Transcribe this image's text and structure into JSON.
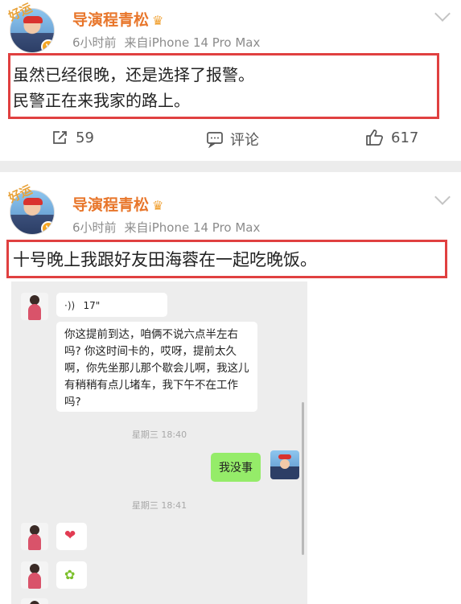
{
  "post1": {
    "author": "导演程青松",
    "lucky_tag": "好运",
    "time": "6小时前",
    "source": "来自iPhone 14 Pro Max",
    "lines": [
      "虽然已经很晚，还是选择了报警。",
      "民警正在来我家的路上。"
    ],
    "repost_count": "59",
    "comment_label": "评论",
    "like_count": "617"
  },
  "post2": {
    "author": "导演程青松",
    "lucky_tag": "好运",
    "time": "6小时前",
    "source": "来自iPhone 14 Pro Max",
    "line": "十号晚上我跟好友田海蓉在一起吃晚饭。"
  },
  "chat": {
    "voice_duration": "17\"",
    "long_message": "你这提前到达，咱俩不说六点半左右吗? 你这时间卡的，哎呀，提前太久啊，你先坐那儿那个歇会儿啊，我这儿有稍稍有点儿堵车，我下午不在工作吗?",
    "timestamp1": "星期三 18:40",
    "my_reply": "我没事",
    "timestamp2": "星期三 18:41"
  },
  "colors": {
    "author": "#e8762b",
    "highlight": "#e04040",
    "green_bubble": "#95ec69"
  }
}
